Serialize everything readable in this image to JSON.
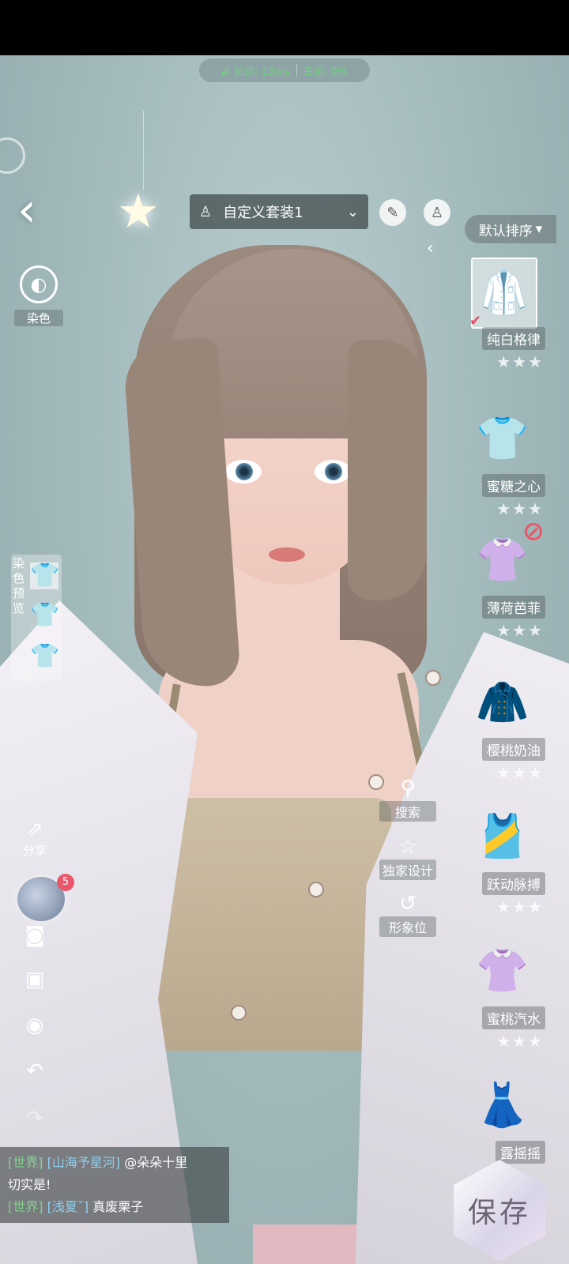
{
  "network": {
    "latency": "延迟: 13ms",
    "loss": "丢包: 0%"
  },
  "top_bar": {
    "outfit_name": "自定义套装1",
    "sort_label": "默认排序"
  },
  "left_tools": {
    "dye_label": "染色",
    "dye_preview_label": "染色预览",
    "share_label": "分享",
    "avatar_badge": "5"
  },
  "mid_actions": {
    "search": "搜索",
    "design": "独家设计",
    "image": "形象位"
  },
  "wardrobe": [
    {
      "name": "纯白格律",
      "stars": "★★★"
    },
    {
      "name": "蜜糖之心",
      "stars": "★★★"
    },
    {
      "name": "薄荷芭菲",
      "stars": "★★★"
    },
    {
      "name": "樱桃奶油",
      "stars": "★★★"
    },
    {
      "name": "跃动脉搏",
      "stars": "★★★"
    },
    {
      "name": "蜜桃汽水",
      "stars": "★★★"
    },
    {
      "name": "露摇摇",
      "stars": ""
    }
  ],
  "save_label": "保存",
  "chat": [
    {
      "channel": "[世界]",
      "user": "[山海予星河]",
      "text": "@朵朵十里"
    },
    {
      "channel": "",
      "user": "",
      "text": "切实是!"
    },
    {
      "channel": "[世界]",
      "user": "[浅夏ˇ]",
      "text": "真废栗子"
    }
  ]
}
